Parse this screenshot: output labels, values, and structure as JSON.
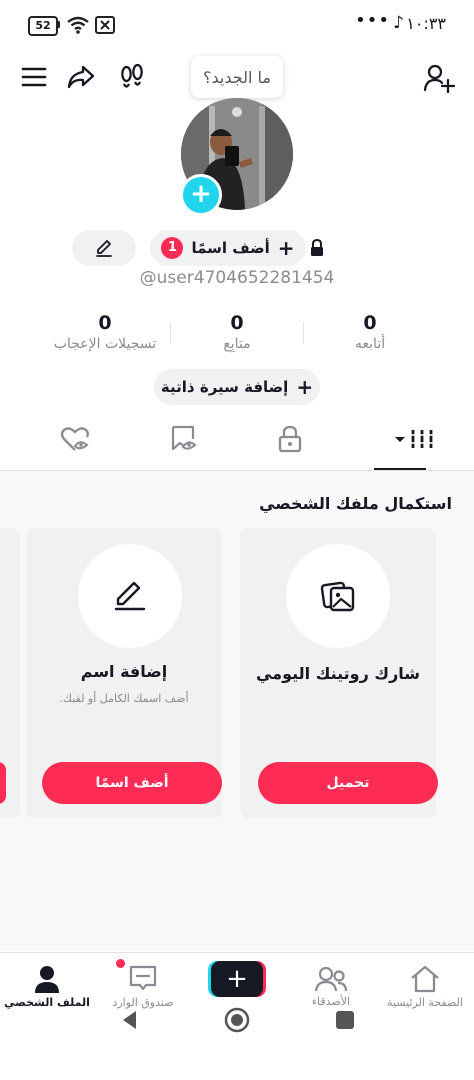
{
  "status_bar": {
    "time": "١٠:٣٣",
    "battery": "52",
    "dots": "•••",
    "tiktok_glyph": "♪"
  },
  "header": {
    "tooltip": "ما الجديد؟",
    "icons": [
      "menu-icon",
      "share-icon",
      "footprints-icon",
      "add-friend-icon"
    ]
  },
  "profile": {
    "add_name_label": "أضف اسمًا",
    "add_name_badge": "1",
    "username": "@user4704652281454",
    "add_bio_label": "إضافة سيرة ذاتية"
  },
  "stats": [
    {
      "value": "0",
      "label": "أتابعه"
    },
    {
      "value": "0",
      "label": "متابِع"
    },
    {
      "value": "0",
      "label": "تسجيلات الإعجاب"
    }
  ],
  "tabs": [
    "videos-grid-icon",
    "private-lock-icon",
    "reposts-icon",
    "liked-icon"
  ],
  "completion": {
    "title": "استكمال ملفك الشخصي",
    "cards": [
      {
        "title": "شارك روتينك اليومي",
        "subtitle": "",
        "button": "تحميل",
        "icon": "photos-icon"
      },
      {
        "title": "إضافة اسم",
        "subtitle": "أضف اسمك الكامل أو لقبك.",
        "button": "أضف اسمًا",
        "icon": "pencil-icon"
      }
    ]
  },
  "bottom_nav": {
    "home": "الصفحة الرئيسية",
    "friends": "الأصدقاء",
    "inbox": "صندوق الوارد",
    "profile": "الملف الشخصي"
  },
  "colors": {
    "accent": "#fe2c55",
    "cyan": "#20d5ec",
    "text": "#161823",
    "muted": "#8a8b91"
  }
}
